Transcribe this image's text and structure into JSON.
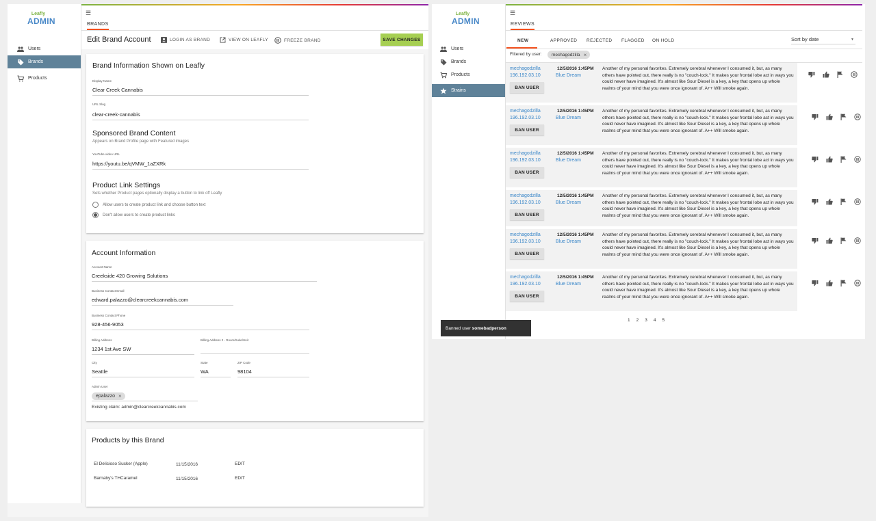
{
  "left": {
    "logo": {
      "small": "Leafly",
      "big": "ADMIN"
    },
    "nav": [
      {
        "label": "Users",
        "icon": "users-icon",
        "active": false
      },
      {
        "label": "Brands",
        "icon": "tag-icon",
        "active": true
      },
      {
        "label": "Products",
        "icon": "cart-icon",
        "active": false
      }
    ],
    "section_tab": "BRANDS",
    "toolbar": {
      "title": "Edit Brand Account",
      "login_as_brand": "LOGIN AS BRAND",
      "view_on_leafly": "VIEW ON LEAFLY",
      "freeze_brand": "FREEZE BRAND",
      "save_changes": "SAVE CHANGES"
    },
    "brand_info": {
      "title": "Brand Information Shown on Leafly",
      "display_name_label": "Display Name",
      "display_name": "Clear Creek Cannabis",
      "slug_label": "URL Slug",
      "slug": "clear-creek-cannabis",
      "sponsored_title": "Sponsored Brand Content",
      "sponsored_sub": "Appears on Brand Profile page with Featured images",
      "youtube_label": "YouTube video URL",
      "youtube": "https://youtu.be/qVMW_1aZXRk",
      "product_link_title": "Product Link Settings",
      "product_link_sub": "Sets whether Product pages optionally display a button to link off Leafly",
      "radio_allow": "Allow users to create product link and choose button text",
      "radio_disallow": "Don't allow users to create product links"
    },
    "account": {
      "title": "Account Information",
      "account_name_label": "Account Name",
      "account_name": "Creekside 420 Growing Solutions",
      "email_label": "Business Contact Email",
      "email": "edward.palazzo@clearcreekcannabis.com",
      "phone_label": "Business Contact Phone",
      "phone": "928-456-9053",
      "billing_label": "Billing Address",
      "billing": "1234 1st Ave SW",
      "billing2_label": "Billing Address 2 - Room/Suite/Unit",
      "billing2": "",
      "city_label": "City",
      "city": "Seattle",
      "state_label": "State",
      "state": "WA",
      "zip_label": "ZIP Code",
      "zip": "98104",
      "admin_label": "Admin User",
      "admin_chip": "epalazzo",
      "existing_claim": "Existing claim: admin@clearcreekcannabis.com"
    },
    "products": {
      "title": "Products by this Brand",
      "rows": [
        {
          "name": "El Delicioso Sucker (Apple)",
          "date": "11/15/2016",
          "action": "EDIT"
        },
        {
          "name": "Barnaby's THCaramel",
          "date": "11/15/2016",
          "action": "EDIT"
        }
      ]
    }
  },
  "right": {
    "logo": {
      "small": "Leafly",
      "big": "ADMIN"
    },
    "nav": [
      {
        "label": "Users",
        "icon": "users-icon",
        "active": false
      },
      {
        "label": "Brands",
        "icon": "tag-icon",
        "active": false
      },
      {
        "label": "Products",
        "icon": "cart-icon",
        "active": false
      },
      {
        "label": "Strains",
        "icon": "star-icon",
        "active": true
      }
    ],
    "section_tab": "REVIEWS",
    "tabs": [
      "NEW",
      "APPROVED",
      "REJECTED",
      "FLAGGED",
      "ON HOLD"
    ],
    "sort_label": "Sort by date",
    "filter_label": "Filtered by user:",
    "filter_chip": "mechagodzilla",
    "ban_label": "BAN USER",
    "reviews": [
      {
        "user": "mechagodzilla",
        "ip": "196.192.03.10",
        "date": "12/5/2016 1:45PM",
        "strain": "Blue Dream",
        "text": "Another of my personal favorites. Extremely cerebral whenever I consumed it, but, as many others have pointed out, there really is no \"couch-lock.\" It makes your frontal lobe act in ways you could never have imagined. It's almost like Sour Diesel is a key, a key that opens up whole realms of your mind that you were once ignorant of. A++ Will smoke again."
      },
      {
        "user": "mechagodzilla",
        "ip": "196.192.03.10",
        "date": "12/5/2016 1:45PM",
        "strain": "Blue Dream",
        "text": "Another of my personal favorites. Extremely cerebral whenever I consumed it, but, as many others have pointed out, there really is no \"couch-lock.\" It makes your frontal lobe act in ways you could never have imagined. It's almost like Sour Diesel is a key, a key that opens up whole realms of your mind that you were once ignorant of. A++ Will smoke again."
      },
      {
        "user": "mechagodzilla",
        "ip": "196.192.03.10",
        "date": "12/5/2016 1:45PM",
        "strain": "Blue Dream",
        "text": "Another of my personal favorites. Extremely cerebral whenever I consumed it, but, as many others have pointed out, there really is no \"couch-lock.\" It makes your frontal lobe act in ways you could never have imagined. It's almost like Sour Diesel is a key, a key that opens up whole realms of your mind that you were once ignorant of. A++ Will smoke again."
      },
      {
        "user": "mechagodzilla",
        "ip": "196.192.03.10",
        "date": "12/5/2016 1:45PM",
        "strain": "Blue Dream",
        "text": "Another of my personal favorites. Extremely cerebral whenever I consumed it, but, as many others have pointed out, there really is no \"couch-lock.\" It makes your frontal lobe act in ways you could never have imagined. It's almost like Sour Diesel is a key, a key that opens up whole realms of your mind that you were once ignorant of. A++ Will smoke again."
      },
      {
        "user": "mechagodzilla",
        "ip": "196.192.03.10",
        "date": "12/5/2016 1:45PM",
        "strain": "Blue Dream",
        "text": "Another of my personal favorites. Extremely cerebral whenever I consumed it, but, as many others have pointed out, there really is no \"couch-lock.\" It makes your frontal lobe act in ways you could never have imagined. It's almost like Sour Diesel is a key, a key that opens up whole realms of your mind that you were once ignorant of. A++ Will smoke again."
      },
      {
        "user": "mechagodzilla",
        "ip": "196.192.03.10",
        "date": "12/5/2016 1:45PM",
        "strain": "Blue Dream",
        "text": "Another of my personal favorites. Extremely cerebral whenever I consumed it, but, as many others have pointed out, there really is no \"couch-lock.\" It makes your frontal lobe act in ways you could never have imagined. It's almost like Sour Diesel is a key, a key that opens up whole realms of your mind that you were once ignorant of. A++ Will smoke again."
      }
    ],
    "pages": [
      "1",
      "2",
      "3",
      "4",
      "5"
    ],
    "snackbar": {
      "prefix": "Banned user ",
      "user": "somebadperson"
    }
  },
  "colors": {
    "accent": "#a6cf52",
    "nav_active": "#5f8299",
    "link": "#3a87c9",
    "tab_underline": "#f4511e"
  }
}
